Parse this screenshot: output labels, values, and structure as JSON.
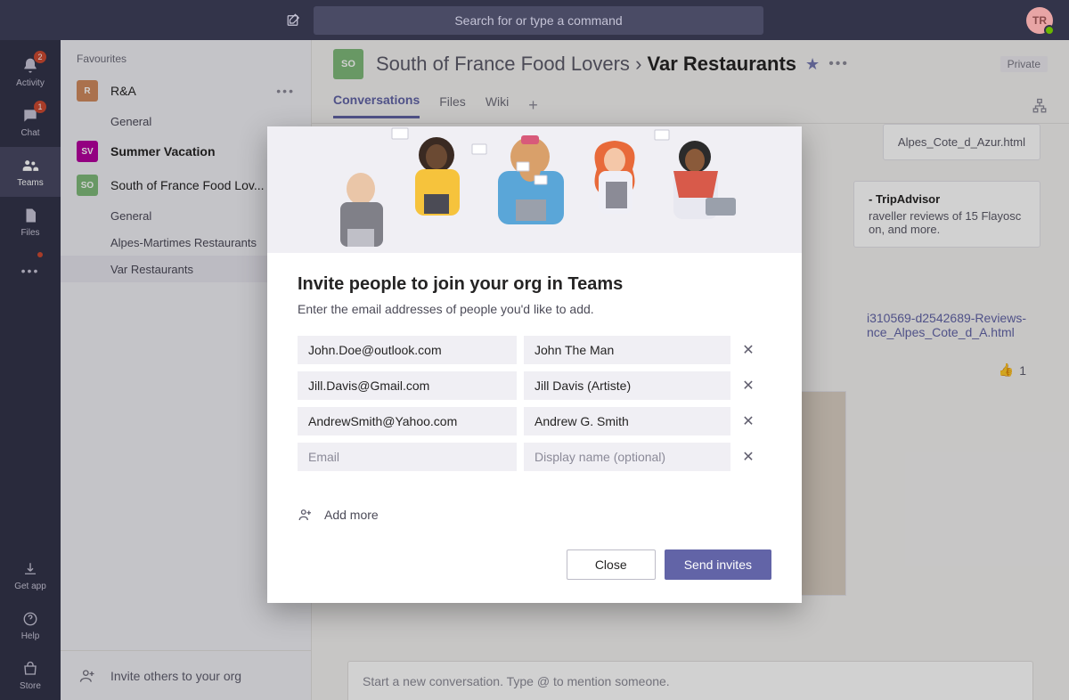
{
  "search": {
    "placeholder": "Search for or type a command"
  },
  "avatar": {
    "initials": "TR"
  },
  "rail": {
    "activity": {
      "label": "Activity",
      "badge": "2"
    },
    "chat": {
      "label": "Chat",
      "badge": "1"
    },
    "teams": {
      "label": "Teams"
    },
    "files": {
      "label": "Files"
    },
    "getapp": {
      "label": "Get app"
    },
    "help": {
      "label": "Help"
    },
    "store": {
      "label": "Store"
    }
  },
  "sidebar": {
    "section": "Favourites",
    "teams": [
      {
        "icon": "R",
        "color": "#d08a5f",
        "name": "R&A",
        "channels": [
          "General"
        ],
        "showMore": true
      },
      {
        "icon": "SV",
        "color": "#b4009e",
        "name": "Summer Vacation",
        "channels": [],
        "bold": true
      },
      {
        "icon": "SO",
        "color": "#7fba7a",
        "name": "South of France Food Lov...",
        "channels": [
          "General",
          "Alpes-Martimes Restaurants",
          "Var Restaurants"
        ],
        "selected": "Var Restaurants"
      }
    ],
    "invite": "Invite others to your org"
  },
  "header": {
    "chip": "SO",
    "parent": "South of France Food Lovers",
    "current": "Var Restaurants",
    "private": "Private"
  },
  "tabs": {
    "items": [
      "Conversations",
      "Files",
      "Wiki"
    ],
    "active": 0
  },
  "compose": {
    "placeholder": "Start a new conversation. Type @ to mention someone."
  },
  "background_fragments": {
    "link1": "Alpes_Cote_d_Azur.html",
    "card_title": "- TripAdvisor",
    "card_line1": "raveller reviews of 15 Flayosc",
    "card_line2": "on, and more.",
    "link2a": "i310569-d2542689-Reviews-",
    "link2b": "nce_Alpes_Cote_d_A.html",
    "like_count": "1"
  },
  "modal": {
    "title": "Invite people to join your org in Teams",
    "subtitle": "Enter the email addresses of people you'd like to add.",
    "rows": [
      {
        "email": "John.Doe@outlook.com",
        "name": "John The Man"
      },
      {
        "email": "Jill.Davis@Gmail.com",
        "name": "Jill Davis (Artiste)"
      },
      {
        "email": "AndrewSmith@Yahoo.com",
        "name": "Andrew G. Smith"
      },
      {
        "email": "",
        "name": ""
      }
    ],
    "email_placeholder": "Email",
    "name_placeholder": "Display name (optional)",
    "add_more": "Add more",
    "close": "Close",
    "send": "Send invites"
  }
}
